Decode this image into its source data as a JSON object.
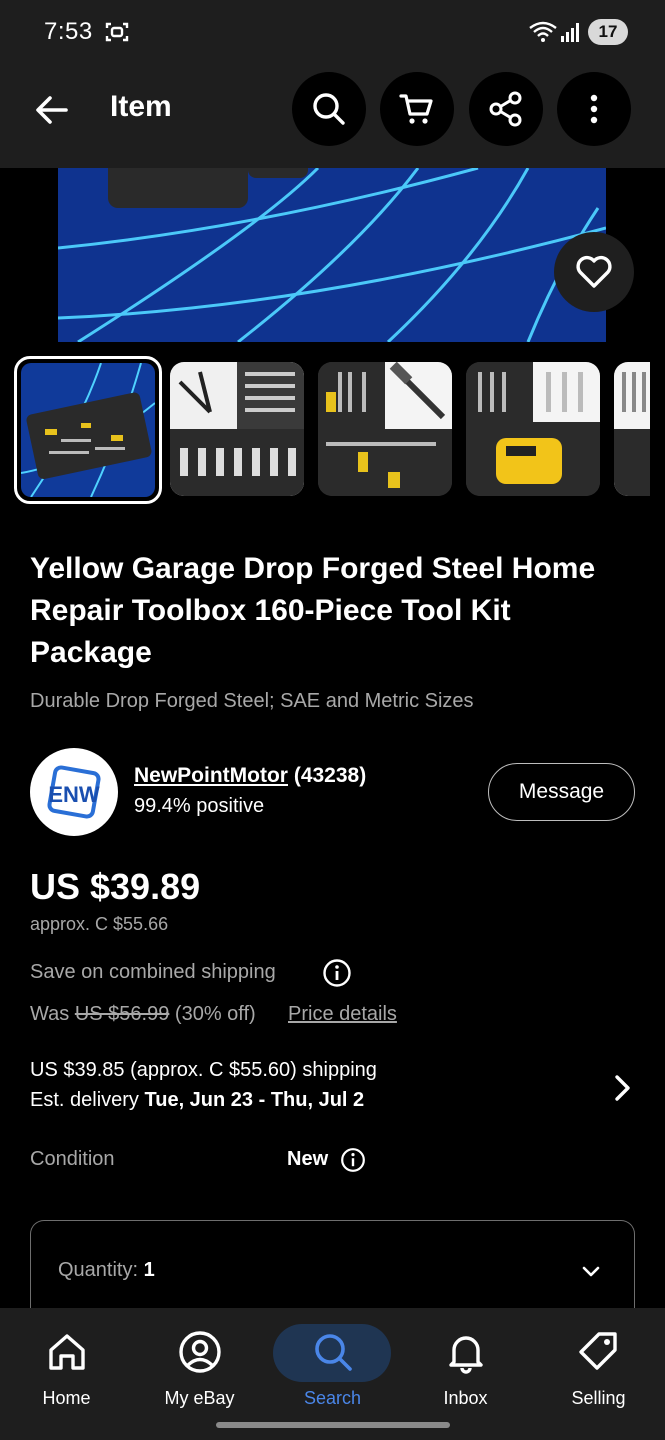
{
  "status_bar": {
    "time": "7:53",
    "battery": "17"
  },
  "app_bar": {
    "title": "Item"
  },
  "product": {
    "title": "Yellow Garage Drop Forged Steel Home Repair Toolbox 160-Piece Tool Kit Package",
    "subtitle": "Durable Drop Forged Steel; SAE and Metric Sizes"
  },
  "seller": {
    "logo_text": "ENW",
    "name": "NewPointMotor",
    "feedback_count": "(43238)",
    "rating": "99.4% positive",
    "message_label": "Message"
  },
  "pricing": {
    "price": "US $39.89",
    "approx": "approx. C $55.66",
    "combined_shipping": "Save on combined shipping",
    "was_label": "Was",
    "was_price": "US $56.99",
    "discount": "(30% off)",
    "price_details_label": "Price details"
  },
  "shipping": {
    "cost": "US $39.85 (approx. C $55.60) shipping",
    "delivery_label": "Est. delivery",
    "delivery_dates": "Tue, Jun 23 - Thu, Jul 2"
  },
  "condition": {
    "label": "Condition",
    "value": "New"
  },
  "quantity": {
    "label": "Quantity:",
    "value": "1"
  },
  "nav": [
    {
      "label": "Home",
      "icon": "home-icon"
    },
    {
      "label": "My eBay",
      "icon": "account-icon"
    },
    {
      "label": "Search",
      "icon": "search-icon",
      "active": true
    },
    {
      "label": "Inbox",
      "icon": "bell-icon"
    },
    {
      "label": "Selling",
      "icon": "tag-icon"
    }
  ],
  "colors": {
    "accent": "#4a86e8",
    "background": "#000000",
    "bar": "#1e1e1e"
  }
}
